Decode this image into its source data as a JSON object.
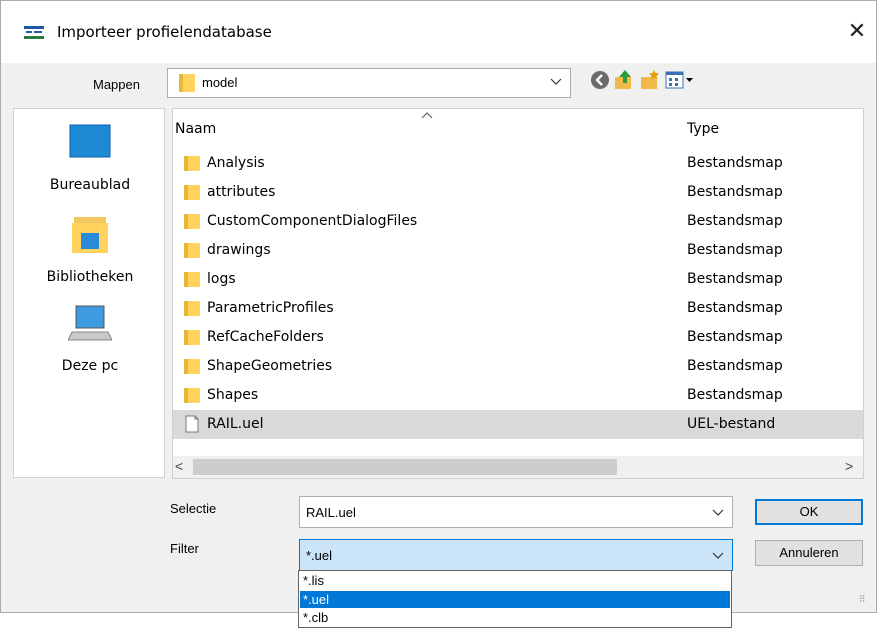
{
  "window": {
    "title": "Importeer profielendatabase",
    "close_glyph": "✕"
  },
  "toolbar": {
    "mappen_label": "Mappen",
    "current_folder": "model",
    "icons": [
      "back-icon",
      "up-folder-icon",
      "new-folder-icon",
      "view-menu-icon"
    ]
  },
  "places": [
    {
      "label": "Bureaublad",
      "icon": "desktop-icon"
    },
    {
      "label": "Bibliotheken",
      "icon": "libraries-icon"
    },
    {
      "label": "Deze pc",
      "icon": "computer-icon"
    }
  ],
  "filelist": {
    "columns": {
      "name": "Naam",
      "type": "Type"
    },
    "rows": [
      {
        "name": "Analysis",
        "type": "Bestandsmap"
      },
      {
        "name": "attributes",
        "type": "Bestandsmap"
      },
      {
        "name": "CustomComponentDialogFiles",
        "type": "Bestandsmap"
      },
      {
        "name": "drawings",
        "type": "Bestandsmap"
      },
      {
        "name": "logs",
        "type": "Bestandsmap"
      },
      {
        "name": "ParametricProfiles",
        "type": "Bestandsmap"
      },
      {
        "name": "RefCacheFolders",
        "type": "Bestandsmap"
      },
      {
        "name": "ShapeGeometries",
        "type": "Bestandsmap"
      },
      {
        "name": "Shapes",
        "type": "Bestandsmap"
      },
      {
        "name": "RAIL.uel",
        "type": "UEL-bestand"
      }
    ],
    "scroll_left": "<",
    "scroll_right": ">"
  },
  "selectie": {
    "label": "Selectie",
    "value": "RAIL.uel"
  },
  "filter": {
    "label": "Filter",
    "value": "*.uel",
    "options": [
      "*.lis",
      "*.uel",
      "*.clb"
    ],
    "selected_index": 1
  },
  "buttons": {
    "ok": "OK",
    "cancel": "Annuleren"
  },
  "colors": {
    "accent": "#0078d7",
    "folder": "#ffd35c",
    "selection_row": "#d9d9d9"
  }
}
